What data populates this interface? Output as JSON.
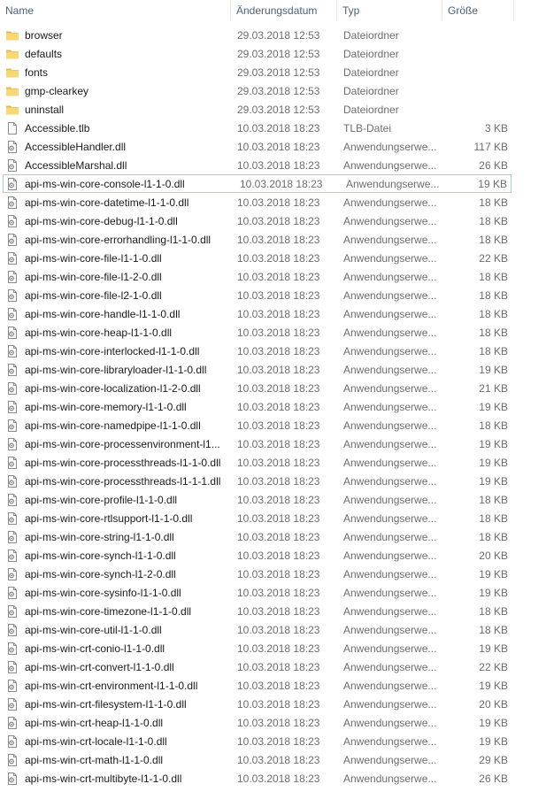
{
  "columns": {
    "name": "Name",
    "date": "Änderungsdatum",
    "type": "Typ",
    "size": "Größe"
  },
  "sort_indicator": "^",
  "files": [
    {
      "name": "browser",
      "date": "29.03.2018 12:53",
      "type": "Dateiordner",
      "size": "",
      "icon": "folder-icon"
    },
    {
      "name": "defaults",
      "date": "29.03.2018 12:53",
      "type": "Dateiordner",
      "size": "",
      "icon": "folder-icon"
    },
    {
      "name": "fonts",
      "date": "29.03.2018 12:53",
      "type": "Dateiordner",
      "size": "",
      "icon": "folder-icon"
    },
    {
      "name": "gmp-clearkey",
      "date": "29.03.2018 12:53",
      "type": "Dateiordner",
      "size": "",
      "icon": "folder-icon"
    },
    {
      "name": "uninstall",
      "date": "29.03.2018 12:53",
      "type": "Dateiordner",
      "size": "",
      "icon": "folder-icon"
    },
    {
      "name": "Accessible.tlb",
      "date": "10.03.2018 18:23",
      "type": "TLB-Datei",
      "size": "3 KB",
      "icon": "file-icon"
    },
    {
      "name": "AccessibleHandler.dll",
      "date": "10.03.2018 18:23",
      "type": "Anwendungserwe...",
      "size": "117 KB",
      "icon": "dll-icon"
    },
    {
      "name": "AccessibleMarshal.dll",
      "date": "10.03.2018 18:23",
      "type": "Anwendungserwe...",
      "size": "26 KB",
      "icon": "dll-icon"
    },
    {
      "name": "api-ms-win-core-console-l1-1-0.dll",
      "date": "10.03.2018 18:23",
      "type": "Anwendungserwe...",
      "size": "19 KB",
      "icon": "dll-icon",
      "focused": true
    },
    {
      "name": "api-ms-win-core-datetime-l1-1-0.dll",
      "date": "10.03.2018 18:23",
      "type": "Anwendungserwe...",
      "size": "18 KB",
      "icon": "dll-icon"
    },
    {
      "name": "api-ms-win-core-debug-l1-1-0.dll",
      "date": "10.03.2018 18:23",
      "type": "Anwendungserwe...",
      "size": "18 KB",
      "icon": "dll-icon"
    },
    {
      "name": "api-ms-win-core-errorhandling-l1-1-0.dll",
      "date": "10.03.2018 18:23",
      "type": "Anwendungserwe...",
      "size": "18 KB",
      "icon": "dll-icon"
    },
    {
      "name": "api-ms-win-core-file-l1-1-0.dll",
      "date": "10.03.2018 18:23",
      "type": "Anwendungserwe...",
      "size": "22 KB",
      "icon": "dll-icon"
    },
    {
      "name": "api-ms-win-core-file-l1-2-0.dll",
      "date": "10.03.2018 18:23",
      "type": "Anwendungserwe...",
      "size": "18 KB",
      "icon": "dll-icon"
    },
    {
      "name": "api-ms-win-core-file-l2-1-0.dll",
      "date": "10.03.2018 18:23",
      "type": "Anwendungserwe...",
      "size": "18 KB",
      "icon": "dll-icon"
    },
    {
      "name": "api-ms-win-core-handle-l1-1-0.dll",
      "date": "10.03.2018 18:23",
      "type": "Anwendungserwe...",
      "size": "18 KB",
      "icon": "dll-icon"
    },
    {
      "name": "api-ms-win-core-heap-l1-1-0.dll",
      "date": "10.03.2018 18:23",
      "type": "Anwendungserwe...",
      "size": "18 KB",
      "icon": "dll-icon"
    },
    {
      "name": "api-ms-win-core-interlocked-l1-1-0.dll",
      "date": "10.03.2018 18:23",
      "type": "Anwendungserwe...",
      "size": "18 KB",
      "icon": "dll-icon"
    },
    {
      "name": "api-ms-win-core-libraryloader-l1-1-0.dll",
      "date": "10.03.2018 18:23",
      "type": "Anwendungserwe...",
      "size": "19 KB",
      "icon": "dll-icon"
    },
    {
      "name": "api-ms-win-core-localization-l1-2-0.dll",
      "date": "10.03.2018 18:23",
      "type": "Anwendungserwe...",
      "size": "21 KB",
      "icon": "dll-icon"
    },
    {
      "name": "api-ms-win-core-memory-l1-1-0.dll",
      "date": "10.03.2018 18:23",
      "type": "Anwendungserwe...",
      "size": "19 KB",
      "icon": "dll-icon"
    },
    {
      "name": "api-ms-win-core-namedpipe-l1-1-0.dll",
      "date": "10.03.2018 18:23",
      "type": "Anwendungserwe...",
      "size": "18 KB",
      "icon": "dll-icon"
    },
    {
      "name": "api-ms-win-core-processenvironment-l1...",
      "date": "10.03.2018 18:23",
      "type": "Anwendungserwe...",
      "size": "19 KB",
      "icon": "dll-icon"
    },
    {
      "name": "api-ms-win-core-processthreads-l1-1-0.dll",
      "date": "10.03.2018 18:23",
      "type": "Anwendungserwe...",
      "size": "19 KB",
      "icon": "dll-icon"
    },
    {
      "name": "api-ms-win-core-processthreads-l1-1-1.dll",
      "date": "10.03.2018 18:23",
      "type": "Anwendungserwe...",
      "size": "19 KB",
      "icon": "dll-icon"
    },
    {
      "name": "api-ms-win-core-profile-l1-1-0.dll",
      "date": "10.03.2018 18:23",
      "type": "Anwendungserwe...",
      "size": "18 KB",
      "icon": "dll-icon"
    },
    {
      "name": "api-ms-win-core-rtlsupport-l1-1-0.dll",
      "date": "10.03.2018 18:23",
      "type": "Anwendungserwe...",
      "size": "18 KB",
      "icon": "dll-icon"
    },
    {
      "name": "api-ms-win-core-string-l1-1-0.dll",
      "date": "10.03.2018 18:23",
      "type": "Anwendungserwe...",
      "size": "18 KB",
      "icon": "dll-icon"
    },
    {
      "name": "api-ms-win-core-synch-l1-1-0.dll",
      "date": "10.03.2018 18:23",
      "type": "Anwendungserwe...",
      "size": "20 KB",
      "icon": "dll-icon"
    },
    {
      "name": "api-ms-win-core-synch-l1-2-0.dll",
      "date": "10.03.2018 18:23",
      "type": "Anwendungserwe...",
      "size": "19 KB",
      "icon": "dll-icon"
    },
    {
      "name": "api-ms-win-core-sysinfo-l1-1-0.dll",
      "date": "10.03.2018 18:23",
      "type": "Anwendungserwe...",
      "size": "19 KB",
      "icon": "dll-icon"
    },
    {
      "name": "api-ms-win-core-timezone-l1-1-0.dll",
      "date": "10.03.2018 18:23",
      "type": "Anwendungserwe...",
      "size": "18 KB",
      "icon": "dll-icon"
    },
    {
      "name": "api-ms-win-core-util-l1-1-0.dll",
      "date": "10.03.2018 18:23",
      "type": "Anwendungserwe...",
      "size": "18 KB",
      "icon": "dll-icon"
    },
    {
      "name": "api-ms-win-crt-conio-l1-1-0.dll",
      "date": "10.03.2018 18:23",
      "type": "Anwendungserwe...",
      "size": "19 KB",
      "icon": "dll-icon"
    },
    {
      "name": "api-ms-win-crt-convert-l1-1-0.dll",
      "date": "10.03.2018 18:23",
      "type": "Anwendungserwe...",
      "size": "22 KB",
      "icon": "dll-icon"
    },
    {
      "name": "api-ms-win-crt-environment-l1-1-0.dll",
      "date": "10.03.2018 18:23",
      "type": "Anwendungserwe...",
      "size": "19 KB",
      "icon": "dll-icon"
    },
    {
      "name": "api-ms-win-crt-filesystem-l1-1-0.dll",
      "date": "10.03.2018 18:23",
      "type": "Anwendungserwe...",
      "size": "20 KB",
      "icon": "dll-icon"
    },
    {
      "name": "api-ms-win-crt-heap-l1-1-0.dll",
      "date": "10.03.2018 18:23",
      "type": "Anwendungserwe...",
      "size": "19 KB",
      "icon": "dll-icon"
    },
    {
      "name": "api-ms-win-crt-locale-l1-1-0.dll",
      "date": "10.03.2018 18:23",
      "type": "Anwendungserwe...",
      "size": "19 KB",
      "icon": "dll-icon"
    },
    {
      "name": "api-ms-win-crt-math-l1-1-0.dll",
      "date": "10.03.2018 18:23",
      "type": "Anwendungserwe...",
      "size": "29 KB",
      "icon": "dll-icon"
    },
    {
      "name": "api-ms-win-crt-multibyte-l1-1-0.dll",
      "date": "10.03.2018 18:23",
      "type": "Anwendungserwe...",
      "size": "26 KB",
      "icon": "dll-icon"
    }
  ],
  "colors": {
    "header_text": "#4c607a",
    "secondary_text": "#6d6d6d",
    "folder_fill": "#f8d775",
    "folder_tab": "#e6b84e",
    "focus_border": "#99d1ff"
  }
}
